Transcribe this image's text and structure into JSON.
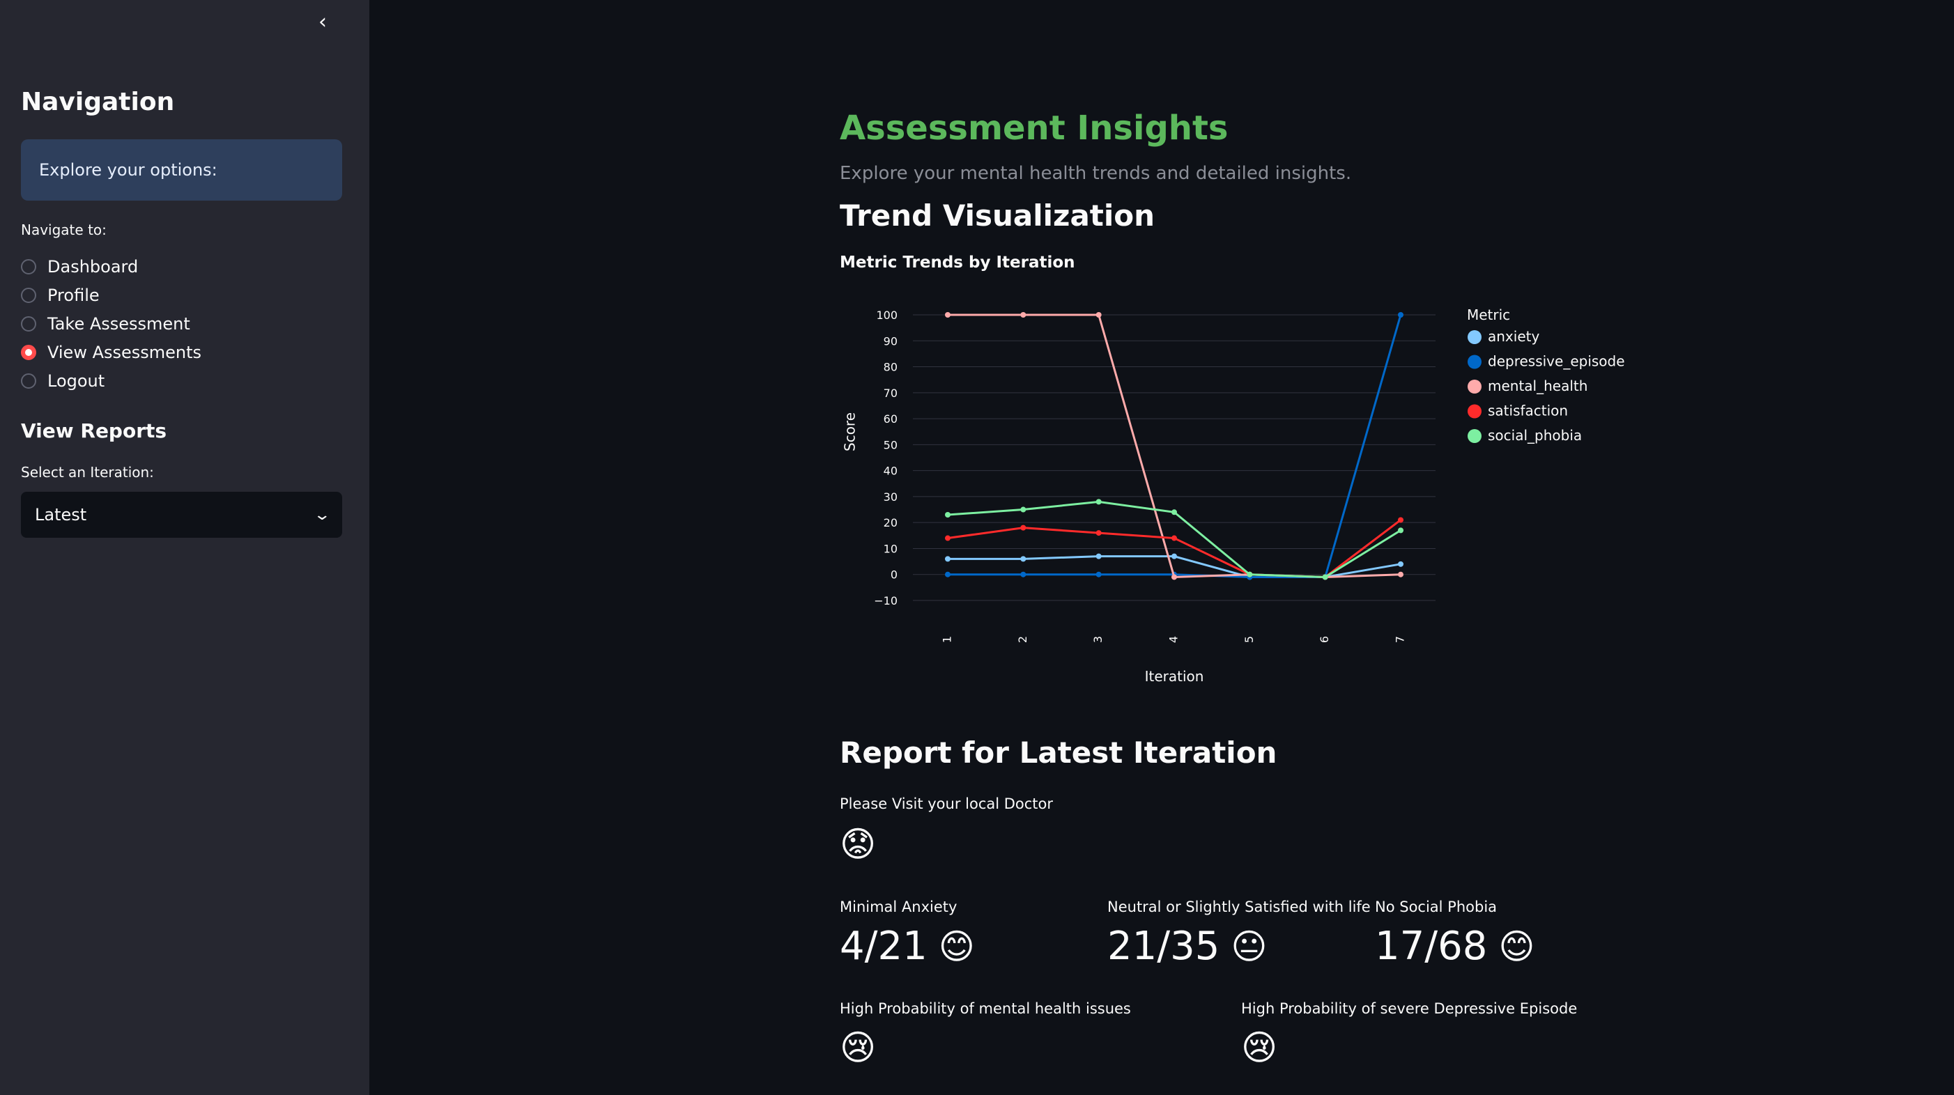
{
  "sidebar": {
    "collapse_icon": "chevron-left-icon",
    "collapse_glyph": "‹",
    "title": "Navigation",
    "info_text": "Explore your options:",
    "radio_label": "Navigate to:",
    "options": [
      "Dashboard",
      "Profile",
      "Take Assessment",
      "View Assessments",
      "Logout"
    ],
    "selected": "View Assessments",
    "reports_title": "View Reports",
    "select_label": "Select an Iteration:",
    "select_value": "Latest",
    "select_icon": "chevron-down-icon"
  },
  "main": {
    "title": "Assessment Insights",
    "subtitle": "Explore your mental health trends and detailed insights.",
    "trend_heading": "Trend Visualization",
    "report_heading": "Report for Latest Iteration",
    "doctor_note": "Please Visit your local Doctor",
    "doctor_emoji": "😟",
    "metrics": [
      {
        "label": "Minimal Anxiety",
        "value": "4/21",
        "emoji": "😊"
      },
      {
        "label": "Neutral or Slightly Satisfied with life",
        "value": "21/35",
        "emoji": "😐"
      },
      {
        "label": "No Social Phobia",
        "value": "17/68",
        "emoji": "😊"
      }
    ],
    "alerts": [
      {
        "label": "High Probability of mental health issues",
        "emoji": "😢"
      },
      {
        "label": "High Probability of severe Depressive Episode",
        "emoji": "😢"
      }
    ]
  },
  "colors": {
    "accent": "#ff4b4b",
    "title_green": "#5cb85c",
    "sidebar_bg": "#262730",
    "main_bg": "#0e1117"
  },
  "chart_data": {
    "type": "line",
    "title": "Metric Trends by Iteration",
    "xlabel": "Iteration",
    "ylabel": "Score",
    "legend_title": "Metric",
    "legend_position": "right",
    "x": [
      1,
      2,
      3,
      4,
      5,
      6,
      7
    ],
    "ylim": [
      -10,
      100
    ],
    "yticks": [
      -10,
      0,
      10,
      20,
      30,
      40,
      50,
      60,
      70,
      80,
      90,
      100
    ],
    "grid": true,
    "series": [
      {
        "name": "anxiety",
        "color": "#83c9ff",
        "values": [
          6,
          6,
          7,
          7,
          -1,
          -1,
          4
        ]
      },
      {
        "name": "depressive_episode",
        "color": "#0068c9",
        "values": [
          0,
          0,
          0,
          0,
          -1,
          -1,
          100
        ]
      },
      {
        "name": "mental_health",
        "color": "#ffabab",
        "values": [
          100,
          100,
          100,
          -1,
          0,
          -1,
          0
        ]
      },
      {
        "name": "satisfaction",
        "color": "#ff2b2b",
        "values": [
          14,
          18,
          16,
          14,
          0,
          -1,
          21
        ]
      },
      {
        "name": "social_phobia",
        "color": "#7defa1",
        "values": [
          23,
          25,
          28,
          24,
          0,
          -1,
          17
        ]
      }
    ]
  }
}
